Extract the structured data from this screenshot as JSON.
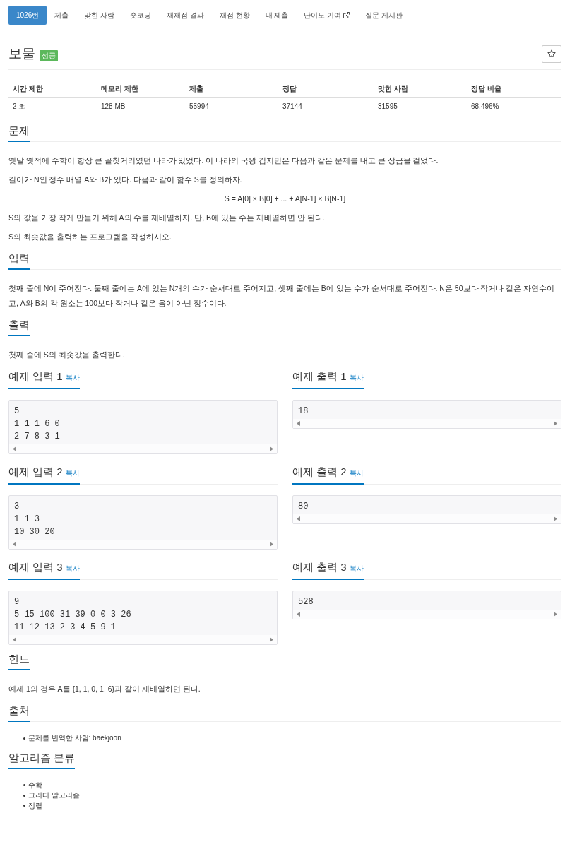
{
  "nav_tabs": [
    {
      "label": "1026번",
      "selected": true,
      "external": false
    },
    {
      "label": "제출",
      "selected": false,
      "external": false
    },
    {
      "label": "맞힌 사람",
      "selected": false,
      "external": false
    },
    {
      "label": "숏코딩",
      "selected": false,
      "external": false
    },
    {
      "label": "재채점 결과",
      "selected": false,
      "external": false
    },
    {
      "label": "채점 현황",
      "selected": false,
      "external": false
    },
    {
      "label": "내 제출",
      "selected": false,
      "external": false
    },
    {
      "label": "난이도 기여",
      "selected": false,
      "external": true
    },
    {
      "label": "질문 게시판",
      "selected": false,
      "external": false
    }
  ],
  "problem": {
    "title": "보물",
    "status_badge": "성공",
    "starred": false
  },
  "info_table": {
    "columns": [
      "시간 제한",
      "메모리 제한",
      "제출",
      "정답",
      "맞힌 사람",
      "정답 비율"
    ],
    "rows": [
      [
        "2 초",
        "128 MB",
        "55994",
        "37144",
        "31595",
        "68.496%"
      ]
    ]
  },
  "sections": [
    {
      "kind": "text",
      "heading": "문제",
      "blocks": [
        {
          "kind": "paragraph",
          "text": "옛날 옛적에 수학이 항상 큰 골칫거리였던 나라가 있었다. 이 나라의 국왕 김지민은 다음과 같은 문제를 내고 큰 상금을 걸었다."
        },
        {
          "kind": "paragraph",
          "text": "길이가 N인 정수 배열 A와 B가 있다. 다음과 같이 함수 S를 정의하자."
        },
        {
          "kind": "formula",
          "text": "S = A[0] × B[0] + ... + A[N-1] × B[N-1]"
        },
        {
          "kind": "paragraph",
          "text": "S의 값을 가장 작게 만들기 위해 A의 수를 재배열하자. 단, B에 있는 수는 재배열하면 안 된다."
        },
        {
          "kind": "paragraph",
          "text": "S의 최솟값을 출력하는 프로그램을 작성하시오."
        }
      ]
    },
    {
      "kind": "text",
      "heading": "입력",
      "blocks": [
        {
          "kind": "paragraph",
          "text": "첫째 줄에 N이 주어진다. 둘째 줄에는 A에 있는 N개의 수가 순서대로 주어지고, 셋째 줄에는 B에 있는 수가 순서대로 주어진다. N은 50보다 작거나 같은 자연수이고, A와 B의 각 원소는 100보다 작거나 같은 음이 아닌 정수이다."
        }
      ]
    },
    {
      "kind": "text",
      "heading": "출력",
      "blocks": [
        {
          "kind": "paragraph",
          "text": "첫째 줄에 S의 최솟값을 출력한다."
        }
      ]
    },
    {
      "kind": "examples",
      "pairs": [
        {
          "input": {
            "heading": "예제 입력 1",
            "copy_link": "복사",
            "text": "5\n1 1 1 6 0\n2 7 8 3 1"
          },
          "output": {
            "heading": "예제 출력 1",
            "copy_link": "복사",
            "text": "18"
          }
        },
        {
          "input": {
            "heading": "예제 입력 2",
            "copy_link": "복사",
            "text": "3\n1 1 3\n10 30 20"
          },
          "output": {
            "heading": "예제 출력 2",
            "copy_link": "복사",
            "text": "80"
          }
        },
        {
          "input": {
            "heading": "예제 입력 3",
            "copy_link": "복사",
            "text": "9\n5 15 100 31 39 0 0 3 26\n11 12 13 2 3 4 5 9 1"
          },
          "output": {
            "heading": "예제 출력 3",
            "copy_link": "복사",
            "text": "528"
          }
        }
      ]
    },
    {
      "kind": "text",
      "heading": "힌트",
      "blocks": [
        {
          "kind": "paragraph",
          "text": "예제 1의 경우 A를 {1, 1, 0, 1, 6}과 같이 재배열하면 된다."
        }
      ]
    },
    {
      "kind": "list",
      "heading": "출처",
      "items": [
        "문제를 번역한 사람: baekjoon"
      ]
    },
    {
      "kind": "list",
      "heading": "알고리즘 분류",
      "items": [
        "수학",
        "그리디 알고리즘",
        "정렬"
      ]
    }
  ]
}
